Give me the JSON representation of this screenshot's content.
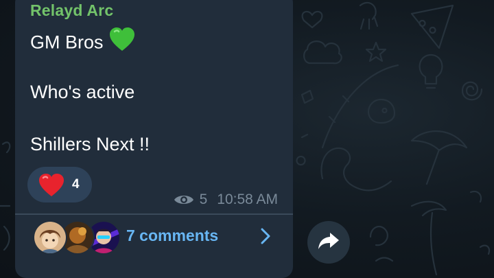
{
  "message": {
    "sender": "Relayd Arc",
    "lines": [
      "GM Bros",
      "Who's active",
      "Shillers Next !!"
    ],
    "line1_emoji": "green-heart",
    "reaction": {
      "emoji": "red-heart",
      "count": "4"
    },
    "views": "5",
    "time": "10:58 AM"
  },
  "comments": {
    "label": "7 comments",
    "avatars": [
      "commenter-avatar-1",
      "commenter-avatar-2",
      "commenter-avatar-3"
    ]
  },
  "icons": {
    "views": "eye-icon",
    "comments_open": "chevron-right-icon",
    "share": "share-icon"
  },
  "colors": {
    "background": "#0f1419",
    "bubble": "#212d3b",
    "sender_name": "#73c36a",
    "message_text": "#ffffff",
    "meta_text": "#7a8a99",
    "link": "#68b6f3",
    "reaction_pill": "#2e4259",
    "share_button": "#263440"
  }
}
